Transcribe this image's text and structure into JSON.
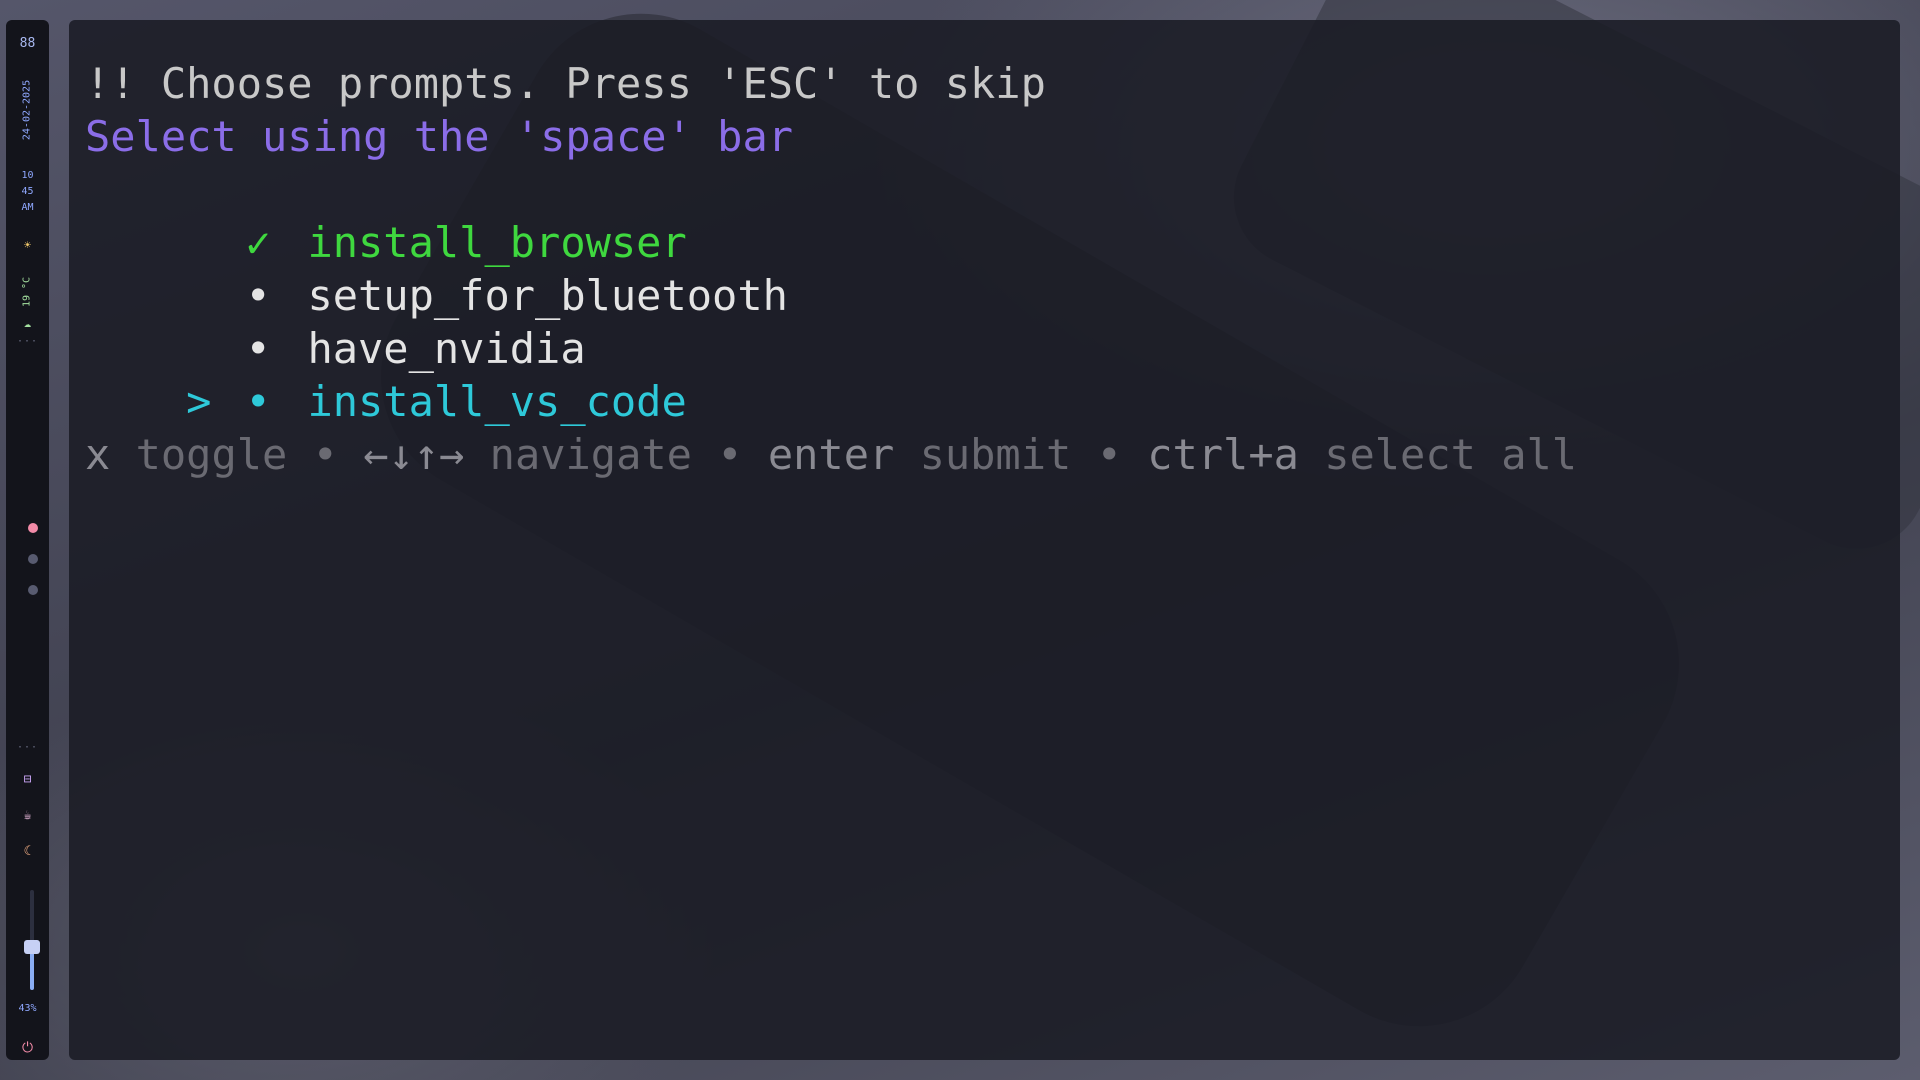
{
  "sidebar": {
    "grid_icon": "88",
    "date": "24-02-2025",
    "time_lines": [
      "10",
      "45",
      "AM"
    ],
    "weather_icon": "sun-icon",
    "temperature": "19 °C",
    "weather_symbol": "☀",
    "cloud_symbol": "☁",
    "dots": "···",
    "workspaces": [
      {
        "active": true,
        "color": "#f38ba8"
      },
      {
        "active": false,
        "color": "#585b70"
      },
      {
        "active": false,
        "color": "#585b70"
      }
    ],
    "network_symbol": "⊟",
    "coffee_symbol": "☕",
    "moon_symbol": "☾",
    "volume_fraction": 0.43,
    "volume_label": "43%",
    "power_symbol": "⏻"
  },
  "terminal": {
    "title": "!! Choose prompts. Press 'ESC' to skip",
    "subtitle": "Select using the 'space' bar",
    "options": [
      {
        "label": "install_browser",
        "marker": "✓",
        "cursor": "",
        "state": "selected"
      },
      {
        "label": "setup_for_bluetooth",
        "marker": "•",
        "cursor": "",
        "state": "unselected"
      },
      {
        "label": "have_nvidia",
        "marker": "•",
        "cursor": "",
        "state": "unselected"
      },
      {
        "label": "install_vs_code",
        "marker": "•",
        "cursor": ">",
        "state": "focused"
      }
    ],
    "help": {
      "toggle_key": "x",
      "toggle_label": "toggle",
      "separator": "•",
      "nav_key": "←↓↑→",
      "nav_label": "navigate",
      "submit_key": "enter",
      "submit_label": "submit",
      "all_key": "ctrl+a",
      "all_label": "select all"
    },
    "colors": {
      "subtitle": "#8b6de8",
      "selected": "#3fd83f",
      "focused": "#2ec9d9",
      "normal": "#e4e4e4",
      "help": "#6a6a72"
    }
  }
}
